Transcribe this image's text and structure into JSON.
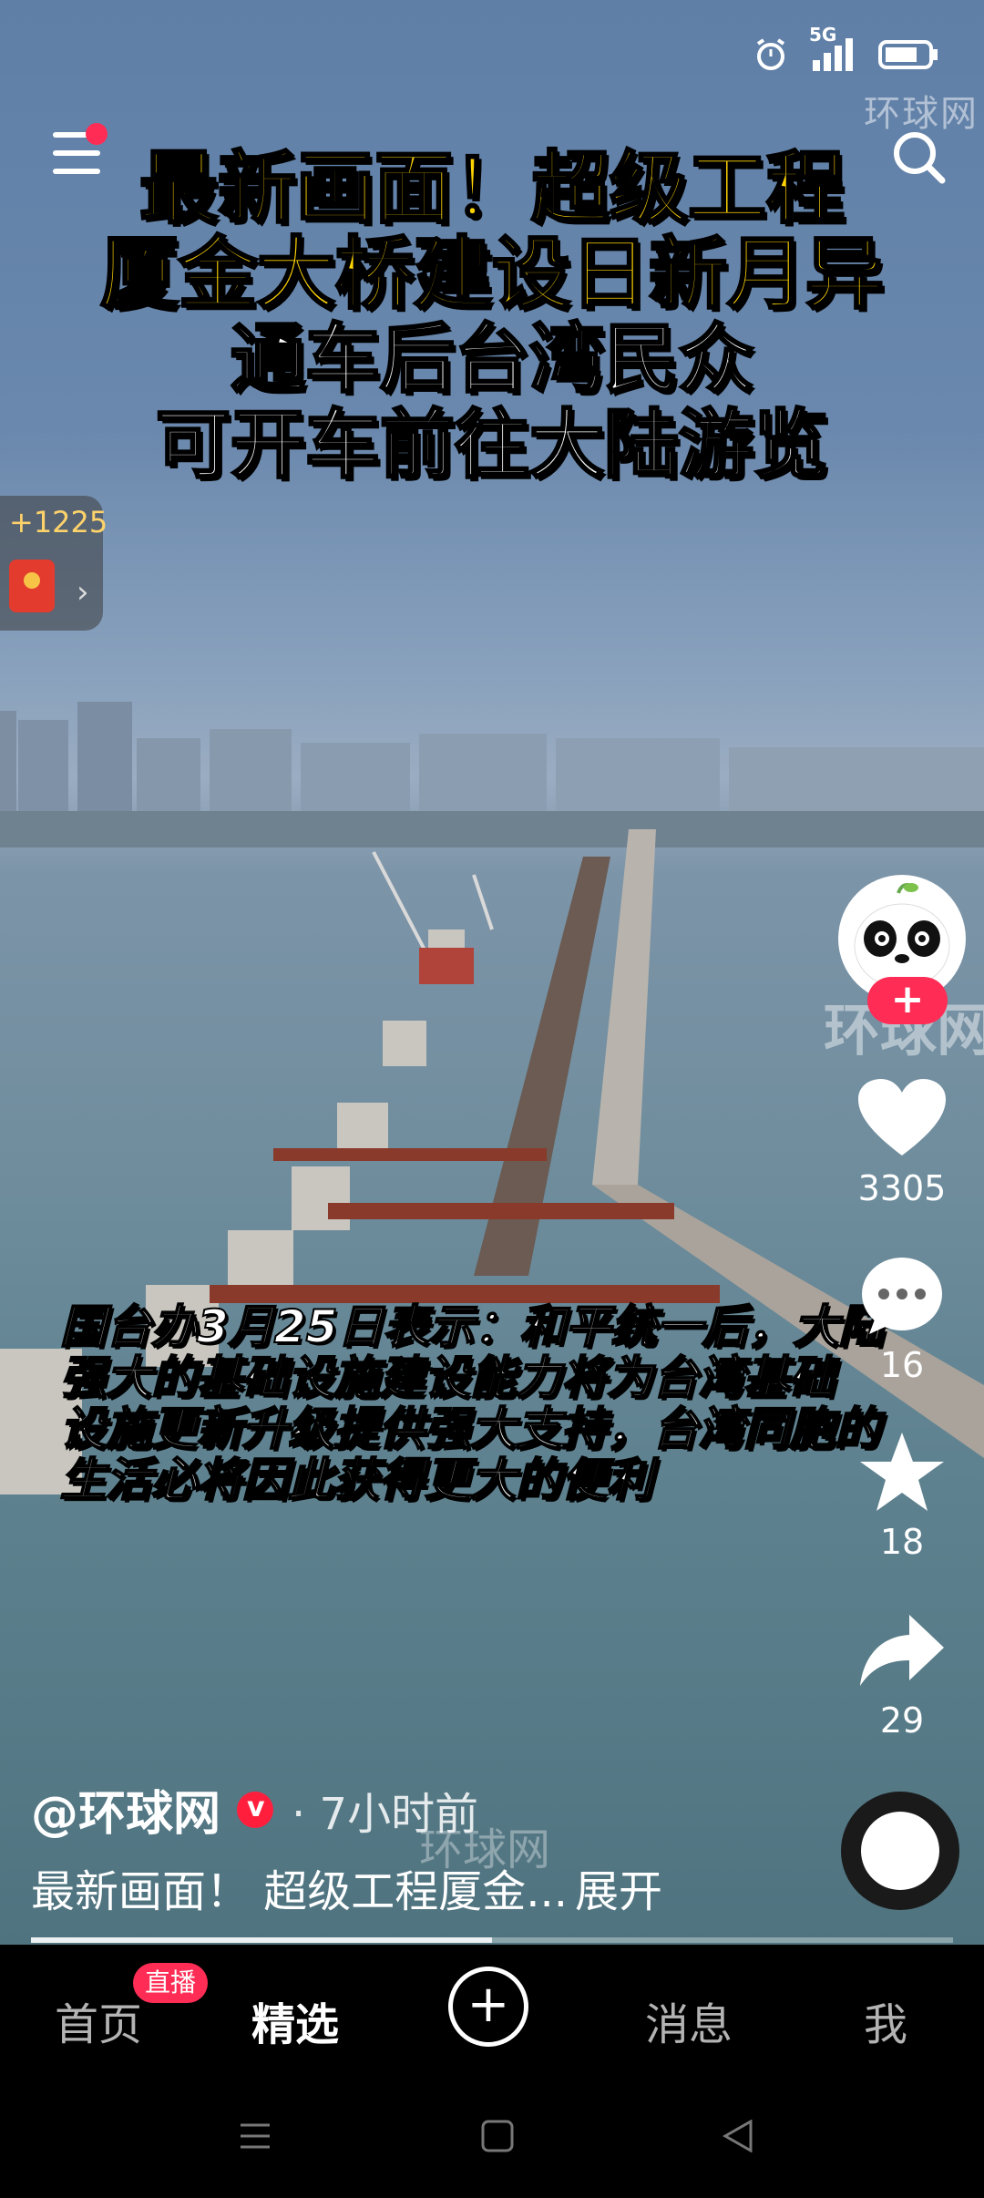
{
  "statusbar": {
    "network": "5G",
    "icons": [
      "alarm-icon",
      "signal-icon",
      "battery-icon"
    ]
  },
  "headline": {
    "line1": "最新画面！超级工程",
    "line2": "厦金大桥建设日新月异",
    "line3": "通车后台湾民众",
    "line4": "可开车前往大陆游览"
  },
  "watermark": "环球网",
  "coins": {
    "value": "+1225"
  },
  "caption_overlay": {
    "line1": "国台办3月25日表示：和平统一后，大陆",
    "line2": "强大的基础设施建设能力将为台湾基础",
    "line3": "设施更新升级提供强大支持，台湾同胞的",
    "line4": "生活必将因此获得更大的便利"
  },
  "actions": {
    "likes": "3305",
    "comments": "16",
    "favorites": "18",
    "shares": "29"
  },
  "post": {
    "author": "@环球网",
    "time_ago": "· 7小时前",
    "description": "最新画面！ 超级工程厦金...",
    "expand": "展开"
  },
  "progress": 0.5,
  "nav": {
    "home": "首页",
    "live_badge": "直播",
    "featured": "精选",
    "create": "+",
    "messages": "消息",
    "me": "我"
  },
  "colors": {
    "accent": "#ff2d55",
    "headline_yellow": "#ffd400"
  }
}
